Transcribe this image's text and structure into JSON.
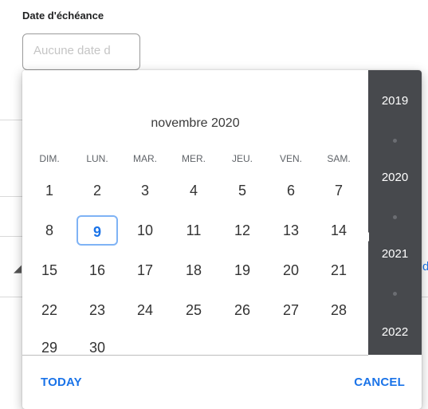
{
  "field": {
    "label": "Date d'échéance",
    "placeholder": "Aucune date d"
  },
  "calendar": {
    "month_title": "novembre 2020",
    "weekdays": [
      "DIM.",
      "LUN.",
      "MAR.",
      "MER.",
      "JEU.",
      "VEN.",
      "SAM."
    ],
    "weeks": [
      [
        "1",
        "2",
        "3",
        "4",
        "5",
        "6",
        "7"
      ],
      [
        "8",
        "9",
        "10",
        "11",
        "12",
        "13",
        "14"
      ],
      [
        "15",
        "16",
        "17",
        "18",
        "19",
        "20",
        "21"
      ],
      [
        "22",
        "23",
        "24",
        "25",
        "26",
        "27",
        "28"
      ],
      [
        "29",
        "30",
        "",
        "",
        "",
        "",
        ""
      ]
    ],
    "today": "9"
  },
  "years": [
    "2019",
    "2020",
    "2021",
    "2022"
  ],
  "actions": {
    "today_label": "TODAY",
    "cancel_label": "CANCEL"
  },
  "colors": {
    "accent": "#1a73e8",
    "year_strip": "#47494d",
    "today_border": "#7fb3f5"
  }
}
